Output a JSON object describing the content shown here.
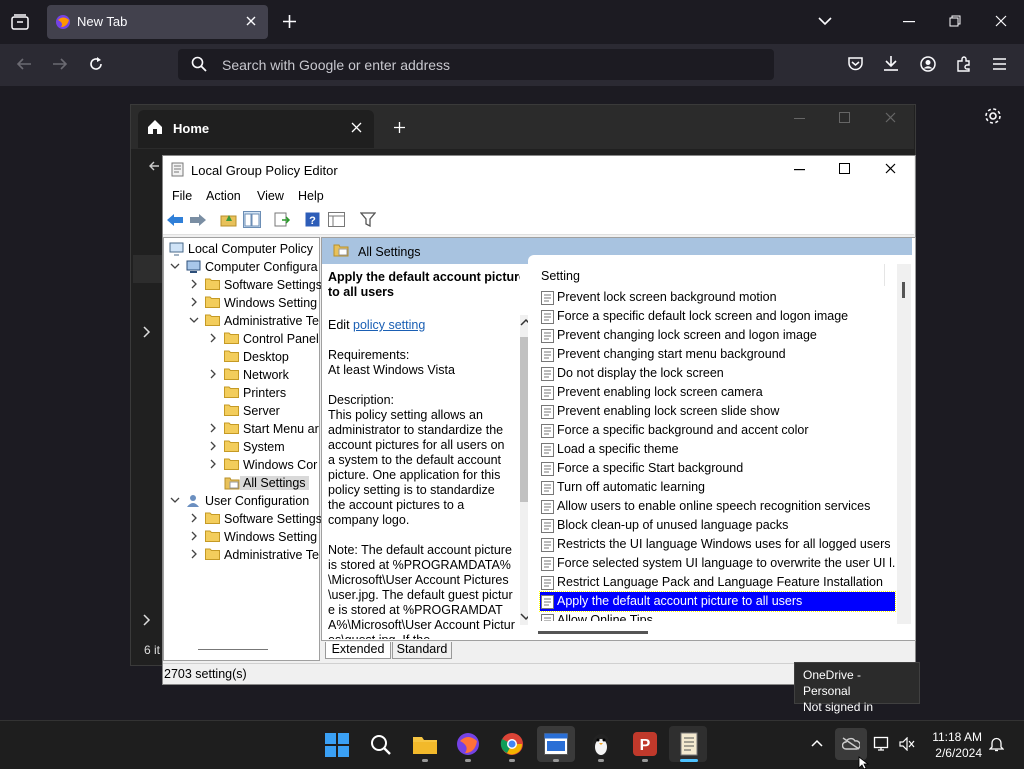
{
  "browser": {
    "tab_title": "New Tab",
    "url_placeholder": "Search with Google or enter address"
  },
  "settings_app": {
    "tab_title": "Home",
    "item_count_partial": "6 it"
  },
  "gpedit": {
    "title": "Local Group Policy Editor",
    "menu": [
      "File",
      "Action",
      "View",
      "Help"
    ],
    "tree": [
      {
        "label": "Local Computer Policy",
        "level": 0,
        "expander": "",
        "icon": "computer-policy"
      },
      {
        "label": "Computer Configura",
        "level": 1,
        "expander": "v",
        "icon": "computer"
      },
      {
        "label": "Software Settings",
        "level": 2,
        "expander": ">",
        "icon": "folder"
      },
      {
        "label": "Windows Setting",
        "level": 2,
        "expander": ">",
        "icon": "folder"
      },
      {
        "label": "Administrative Te",
        "level": 2,
        "expander": "v",
        "icon": "folder"
      },
      {
        "label": "Control Panel",
        "level": 3,
        "expander": ">",
        "icon": "folder"
      },
      {
        "label": "Desktop",
        "level": 3,
        "expander": "",
        "icon": "folder"
      },
      {
        "label": "Network",
        "level": 3,
        "expander": ">",
        "icon": "folder"
      },
      {
        "label": "Printers",
        "level": 3,
        "expander": "",
        "icon": "folder"
      },
      {
        "label": "Server",
        "level": 3,
        "expander": "",
        "icon": "folder"
      },
      {
        "label": "Start Menu ar",
        "level": 3,
        "expander": ">",
        "icon": "folder"
      },
      {
        "label": "System",
        "level": 3,
        "expander": ">",
        "icon": "folder"
      },
      {
        "label": "Windows Cor",
        "level": 3,
        "expander": ">",
        "icon": "folder"
      },
      {
        "label": "All Settings",
        "level": 3,
        "expander": "",
        "icon": "folder-open",
        "selected": true
      },
      {
        "label": "User Configuration",
        "level": 1,
        "expander": "v",
        "icon": "user"
      },
      {
        "label": "Software Settings",
        "level": 2,
        "expander": ">",
        "icon": "folder"
      },
      {
        "label": "Windows Setting",
        "level": 2,
        "expander": ">",
        "icon": "folder"
      },
      {
        "label": "Administrative Te",
        "level": 2,
        "expander": ">",
        "icon": "folder"
      }
    ],
    "pane_header": "All Settings",
    "description": {
      "title": "Apply the default account picture to all users",
      "edit_prefix": "Edit",
      "edit_link": "policy setting",
      "requirements_label": "Requirements:",
      "requirements_value": "At least Windows Vista",
      "description_label": "Description:",
      "description_text": "This policy setting allows an administrator to standardize the account pictures for all users on a system to the default account picture. One application for this policy setting is to standardize the account pictures to a company logo.",
      "note_text": "Note: The default account picture is stored at %PROGRAMDATA%\\Microsoft\\User Account Pictures\\user.jpg. The default guest picture is stored at %PROGRAMDATA%\\Microsoft\\User Account Pictures\\guest.jpg. If the"
    },
    "column_header": "Setting",
    "settings": [
      "Prevent lock screen background motion",
      "Force a specific default lock screen and logon image",
      "Prevent changing lock screen and logon image",
      "Prevent changing start menu background",
      "Do not display the lock screen",
      "Prevent enabling lock screen camera",
      "Prevent enabling lock screen slide show",
      "Force a specific background and accent color",
      "Load a specific theme",
      "Force a specific Start background",
      "Turn off automatic learning",
      "Allow users to enable online speech recognition services",
      "Block clean-up of unused language packs",
      "Restricts the UI language Windows uses for all logged users",
      "Force selected system UI language to overwrite the user UI l...",
      "Restrict Language Pack and Language Feature Installation",
      "Apply the default account picture to all users",
      "Allow Online Tips"
    ],
    "selected_setting_index": 16,
    "bottom_tabs": [
      "Extended",
      "Standard"
    ],
    "status": "2703 setting(s)"
  },
  "tooltip": {
    "line1": "OneDrive - Personal",
    "line2": "Not signed in"
  },
  "taskbar": {
    "time": "11:18 AM",
    "date": "2/6/2024"
  }
}
